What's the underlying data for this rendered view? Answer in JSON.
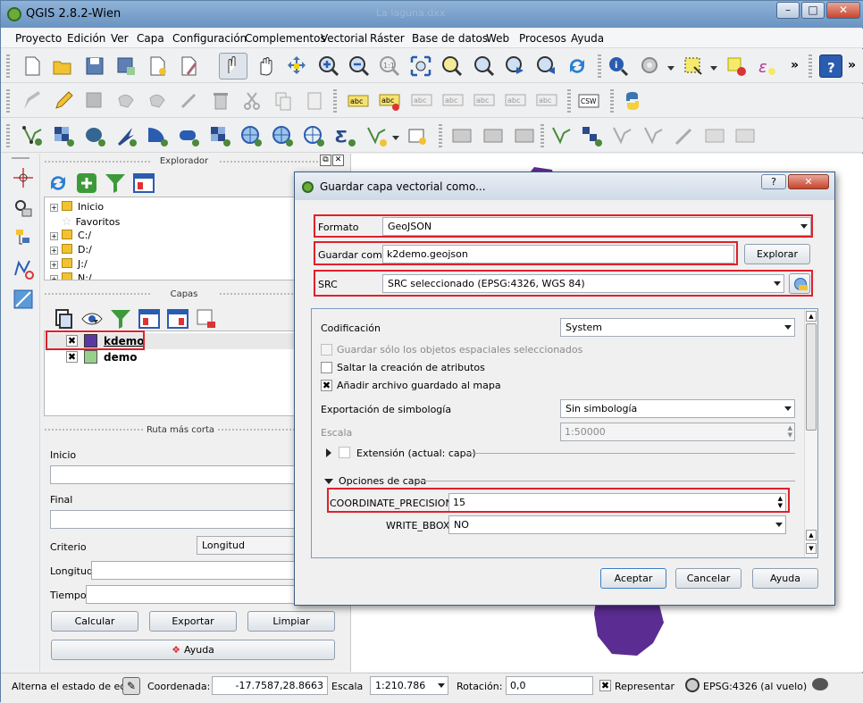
{
  "app": {
    "title": "QGIS 2.8.2-Wien",
    "hidden_title": "La laguna.dxx"
  },
  "window_buttons": {
    "minimize": "–",
    "maximize": "□",
    "close": "✕"
  },
  "menu": [
    "Proyecto",
    "Edición",
    "Ver",
    "Capa",
    "Configuración",
    "Complementos",
    "Vectorial",
    "Ráster",
    "Base de datos",
    "Web",
    "Procesos",
    "Ayuda"
  ],
  "toolbar": {
    "overflow": "»",
    "csw": "CSW",
    "abc": "abc"
  },
  "explorer": {
    "title": "Explorador",
    "items": [
      "Inicio",
      "Favoritos",
      "C:/",
      "D:/",
      "J:/",
      "N:/"
    ]
  },
  "layers": {
    "title": "Capas",
    "items": [
      {
        "name": "kdemo",
        "color": "#5b3aa0",
        "checked": true
      },
      {
        "name": "demo",
        "color": "#97d08b",
        "checked": true
      }
    ]
  },
  "route": {
    "title": "Ruta más corta",
    "start_label": "Inicio",
    "end_label": "Final",
    "criterion_label": "Criterio",
    "criterion_value": "Longitud",
    "length_label": "Longitud",
    "time_label": "Tiempo",
    "calc": "Calcular",
    "export": "Exportar",
    "clear": "Limpiar",
    "help": "Ayuda"
  },
  "dialog": {
    "title": "Guardar capa vectorial como...",
    "help_btn": "?",
    "format_label": "Formato",
    "format_value": "GeoJSON",
    "saveas_label": "Guardar como",
    "saveas_value": "k2demo.geojson",
    "browse": "Explorar",
    "src_label": "SRC",
    "src_value": "SRC seleccionado (EPSG:4326, WGS 84)",
    "encoding_label": "Codificación",
    "encoding_value": "System",
    "only_selected": "Guardar sólo los objetos espaciales seleccionados",
    "skip_attrs": "Saltar la creación de atributos",
    "add_to_map": "Añadir archivo guardado al mapa",
    "symbology_label": "Exportación de simbología",
    "symbology_value": "Sin simbología",
    "scale_label": "Escala",
    "scale_value": "1:50000",
    "extent_label": "Extensión (actual: capa)",
    "layer_options": "Opciones de capa",
    "coord_label": "COORDINATE_PRECISION",
    "coord_value": "15",
    "bbox_label": "WRITE_BBOX",
    "bbox_value": "NO",
    "accept": "Aceptar",
    "cancel": "Cancelar",
    "help": "Ayuda"
  },
  "status": {
    "toggle": "Alterna el estado de edici",
    "coord_label": "Coordenada:",
    "coord_value": "-17.7587,28.8663",
    "scale_label": "Escala",
    "scale_value": "1:210.786",
    "rotation_label": "Rotación:",
    "rotation_value": "0,0",
    "render_label": "Representar",
    "crs": "EPSG:4326 (al vuelo)"
  },
  "colors": {
    "highlight": "#e0202a",
    "layer_purple": "#5b2c91"
  }
}
